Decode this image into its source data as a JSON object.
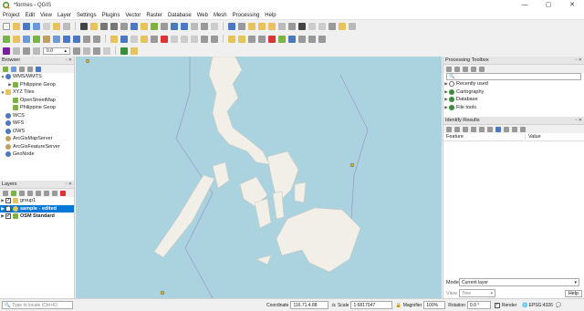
{
  "window": {
    "title": "*formes - QGIS",
    "min": "—",
    "max": "▢",
    "close": "✕"
  },
  "menu": [
    "Project",
    "Edit",
    "View",
    "Layer",
    "Settings",
    "Plugins",
    "Vector",
    "Raster",
    "Database",
    "Web",
    "Mesh",
    "Processing",
    "Help"
  ],
  "toolbar": {
    "snap_value": "0.0",
    "spin_up": "▴"
  },
  "browser": {
    "title": "Browser",
    "items": [
      {
        "label": "WMS/WMTS",
        "level": 0,
        "expanded": true,
        "icon": "globe-icon"
      },
      {
        "label": "Philippine Geop",
        "level": 1,
        "icon": "map-icon"
      },
      {
        "label": "XYZ Tiles",
        "level": 0,
        "expanded": true,
        "icon": "tiles-icon"
      },
      {
        "label": "OpenStreetMap",
        "level": 1,
        "icon": "map-icon"
      },
      {
        "label": "Philippine Geop",
        "level": 1,
        "icon": "map-icon"
      },
      {
        "label": "WCS",
        "level": 0,
        "icon": "globe-icon"
      },
      {
        "label": "WFS",
        "level": 0,
        "icon": "globe-icon"
      },
      {
        "label": "OWS",
        "level": 0,
        "icon": "globe-icon"
      },
      {
        "label": "ArcGisMapServer",
        "level": 0,
        "icon": "arcgis-icon"
      },
      {
        "label": "ArcGisFeatureServer",
        "level": 0,
        "icon": "arcgis-icon"
      },
      {
        "label": "GeoNode",
        "level": 0,
        "icon": "geonode-icon"
      }
    ]
  },
  "layers": {
    "title": "Layers",
    "items": [
      {
        "label": "group1",
        "checked": true,
        "bold": false,
        "selected": false
      },
      {
        "label": "sample - edited",
        "checked": true,
        "bold": true,
        "selected": true
      },
      {
        "label": "OSM Standard",
        "checked": true,
        "bold": true,
        "selected": false
      }
    ]
  },
  "processing": {
    "title": "Processing Toolbox",
    "search_placeholder": "",
    "items": [
      {
        "label": "Recently used",
        "icon": "clock-icon"
      },
      {
        "label": "Cartography",
        "icon": "cartography-icon"
      },
      {
        "label": "Database",
        "icon": "database-icon"
      },
      {
        "label": "File tools",
        "icon": "file-tools-icon"
      }
    ]
  },
  "identify": {
    "title": "Identify Results",
    "col_feature": "Feature",
    "col_value": "Value",
    "mode_label": "Mode",
    "mode_value": "Current layer",
    "view_label": "View",
    "view_value": "Tree",
    "help_label": "Help"
  },
  "status": {
    "locator_placeholder": "Type to locate (Ctrl+K)",
    "coordinate_label": "Coordinate",
    "coordinate_value": "116.71,4.88",
    "scale_label": "Scale",
    "scale_value": "1:6817047",
    "magnifier_label": "Magnifier",
    "magnifier_value": "100%",
    "rotation_label": "Rotation",
    "rotation_value": "0.0 °",
    "render_label": "Render",
    "crs_label": "EPSG:4326"
  },
  "colors": {
    "sea": "#aad3df",
    "land": "#f2efe9",
    "selection": "#0078d7",
    "qgis_green": "#589632"
  }
}
